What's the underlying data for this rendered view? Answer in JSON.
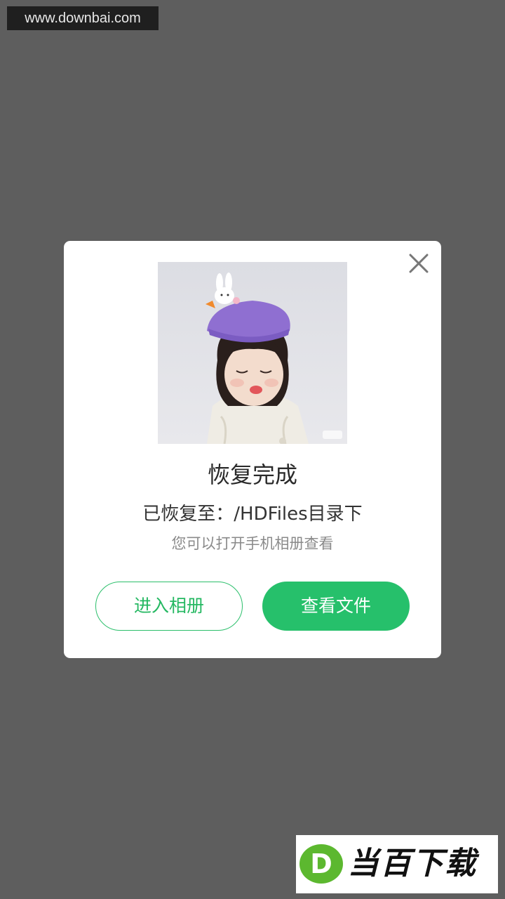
{
  "watermark": {
    "url_text": "www.downbai.com"
  },
  "dialog": {
    "title": "恢复完成",
    "path_message": "已恢复至：/HDFiles目录下",
    "hint": "您可以打开手机相册查看",
    "buttons": {
      "open_album": "进入相册",
      "view_files": "查看文件"
    },
    "close_icon": "close-icon",
    "photo_icon": "recovered-photo"
  },
  "brand": {
    "logo_letter": "D",
    "logo_text": "当百下载"
  },
  "colors": {
    "overlay": "#5e5e5e",
    "accent_green": "#26c06b",
    "dialog_bg": "#ffffff"
  }
}
